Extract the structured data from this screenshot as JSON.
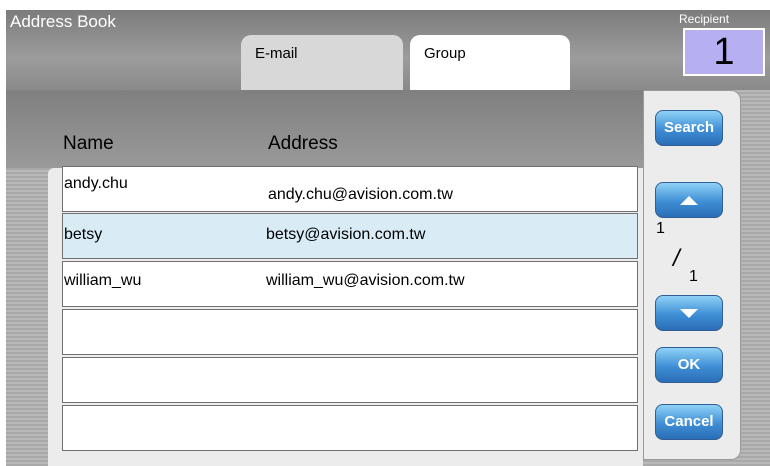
{
  "header": {
    "title": "Address Book",
    "tabs": [
      {
        "label": "E-mail",
        "active": false
      },
      {
        "label": "Group",
        "active": true
      }
    ],
    "recipient_label": "Recipient",
    "recipient_count": "1"
  },
  "list": {
    "columns": [
      "Name",
      "Address"
    ],
    "rows": [
      {
        "name": "andy.chu",
        "address": "andy.chu@avision.com.tw",
        "selected": false
      },
      {
        "name": "betsy",
        "address": "betsy@avision.com.tw",
        "selected": true
      },
      {
        "name": "william_wu",
        "address": "william_wu@avision.com.tw",
        "selected": false
      },
      {
        "name": "",
        "address": "",
        "selected": false
      },
      {
        "name": "",
        "address": "",
        "selected": false
      },
      {
        "name": "",
        "address": "",
        "selected": false
      }
    ]
  },
  "sidebar": {
    "search_label": "Search",
    "up_icon": "arrow-up-icon",
    "down_icon": "arrow-down-icon",
    "current_page": "1",
    "slash": "/",
    "total_pages": "1",
    "ok_label": "OK",
    "cancel_label": "Cancel"
  },
  "colors": {
    "button_blue": "#3f8ed6",
    "selected_row": "#d9ecf6",
    "recipient_box": "#b6b0f2"
  }
}
